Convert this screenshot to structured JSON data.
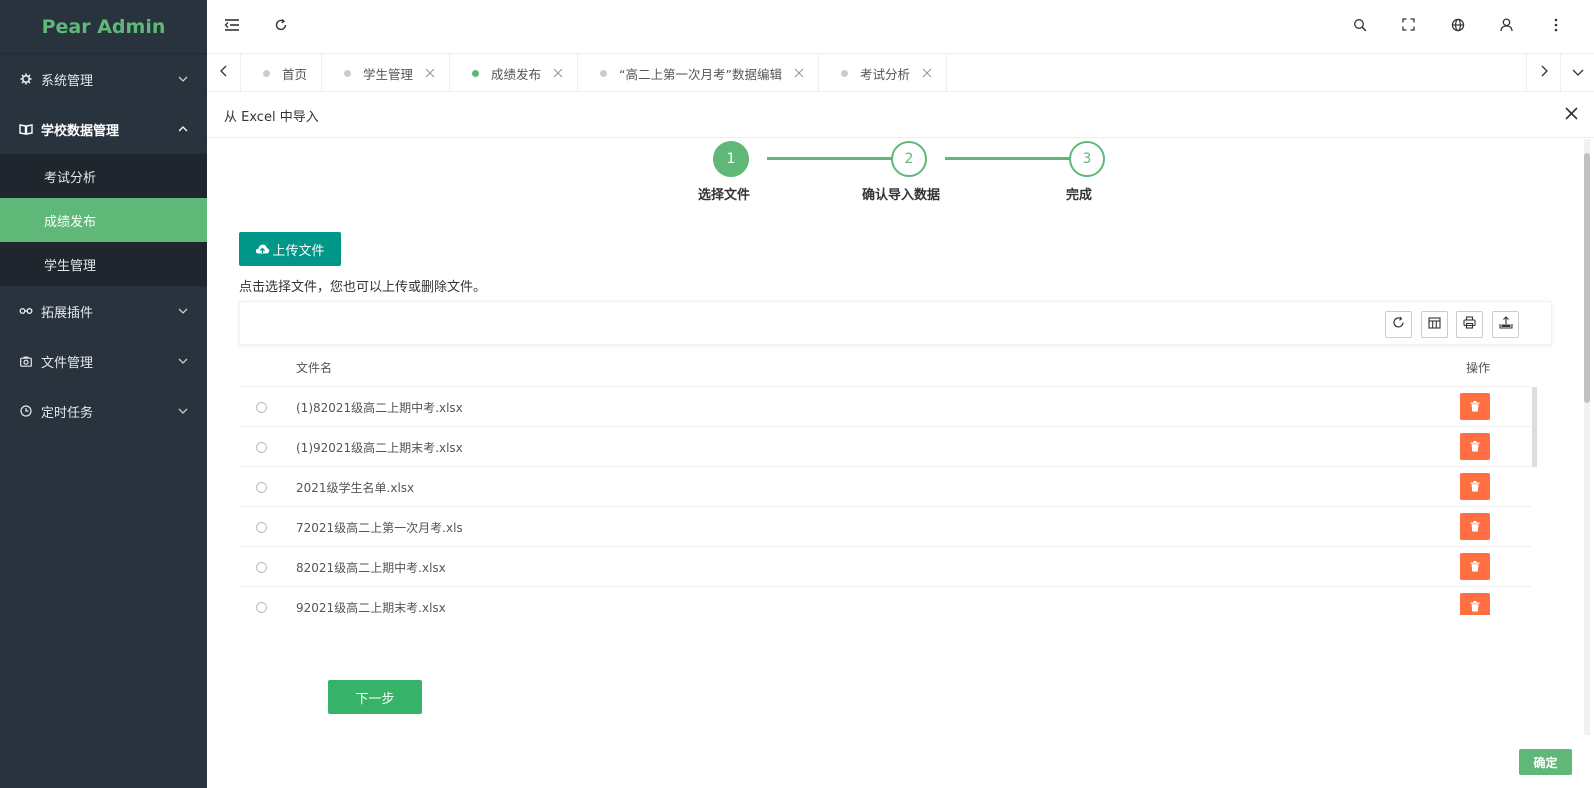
{
  "app": {
    "title": "Pear Admin"
  },
  "sidebar": {
    "items": [
      {
        "label": "系统管理",
        "icon": "gear-icon",
        "open": false
      },
      {
        "label": "学校数据管理",
        "icon": "book-icon",
        "open": true,
        "children": [
          {
            "label": "考试分析"
          },
          {
            "label": "成绩发布",
            "active": true
          },
          {
            "label": "学生管理"
          }
        ]
      },
      {
        "label": "拓展插件",
        "icon": "link-icon",
        "open": false
      },
      {
        "label": "文件管理",
        "icon": "camera-icon",
        "open": false
      },
      {
        "label": "定时任务",
        "icon": "clock-icon",
        "open": false
      }
    ]
  },
  "tabs": [
    {
      "label": "首页",
      "closable": false
    },
    {
      "label": "学生管理",
      "closable": true
    },
    {
      "label": "成绩发布",
      "closable": true,
      "active": true
    },
    {
      "label": "“高二上第一次月考”数据编辑",
      "closable": true
    },
    {
      "label": "考试分析",
      "closable": true
    }
  ],
  "modal": {
    "title": "从 Excel 中导入",
    "steps": [
      {
        "number": "1",
        "label": "选择文件",
        "done": true
      },
      {
        "number": "2",
        "label": "确认导入数据",
        "done": false
      },
      {
        "number": "3",
        "label": "完成",
        "done": false
      }
    ],
    "upload_label": "上传文件",
    "hint": "点击选择文件，您也可以上传或删除文件。",
    "table": {
      "columns": [
        "文件名",
        "操作"
      ],
      "rows": [
        "(1)82021级高二上期中考.xlsx",
        "(1)92021级高二上期末考.xlsx",
        "2021级学生名单.xlsx",
        "72021级高二上第一次月考.xls",
        "82021级高二上期中考.xlsx",
        "92021级高二上期末考.xlsx"
      ]
    },
    "next_label": "下一步",
    "ok_label": "确定"
  },
  "colors": {
    "accent": "#5fb878",
    "sidebar_bg": "#28333e",
    "upload_btn": "#009688",
    "danger": "#ff5722"
  }
}
